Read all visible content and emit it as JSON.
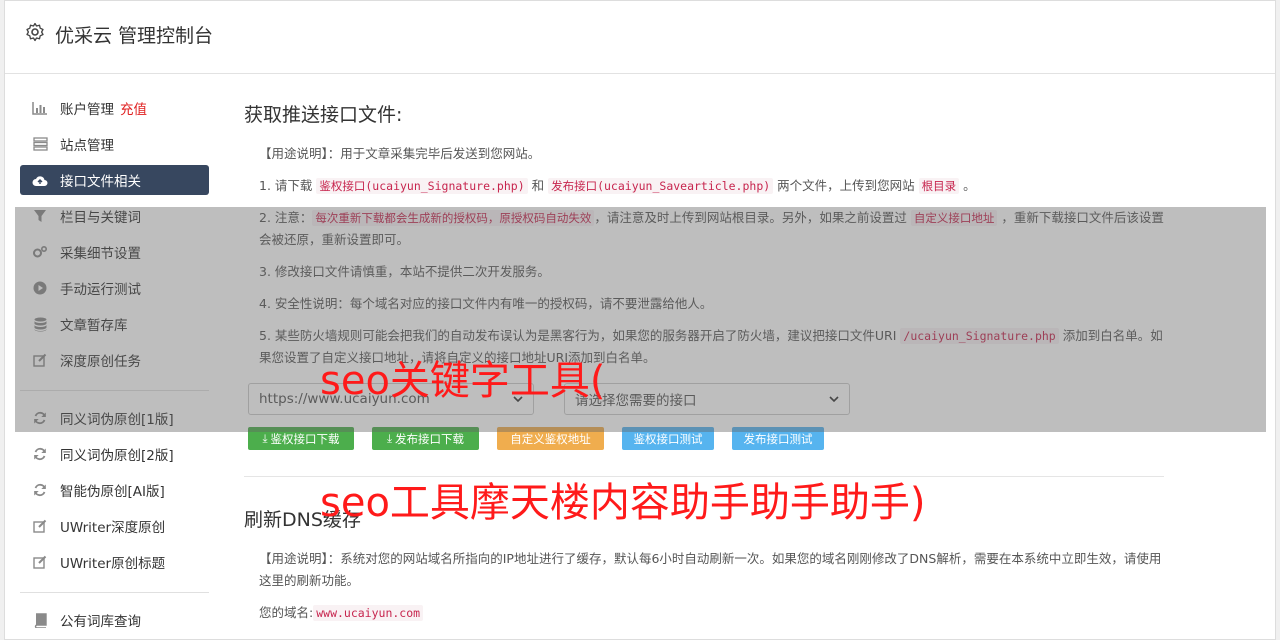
{
  "app": {
    "title": "优采云 管理控制台"
  },
  "sidebar": {
    "items": [
      {
        "label": "账户管理",
        "extra": "充值",
        "icon": "bar-chart-icon"
      },
      {
        "label": "站点管理",
        "icon": "server-icon"
      },
      {
        "label": "接口文件相关",
        "icon": "cloud-upload-icon",
        "active": true
      },
      {
        "label": "栏目与关键词",
        "icon": "filter-icon"
      },
      {
        "label": "采集细节设置",
        "icon": "cogs-icon"
      },
      {
        "label": "手动运行测试",
        "icon": "play-circle-icon"
      },
      {
        "label": "文章暂存库",
        "icon": "database-icon"
      },
      {
        "label": "深度原创任务",
        "icon": "edit-icon"
      }
    ],
    "items2": [
      {
        "label": "同义词伪原创[1版]",
        "icon": "refresh-icon"
      },
      {
        "label": "同义词伪原创[2版]",
        "icon": "refresh-icon"
      },
      {
        "label": "智能伪原创[AI版]",
        "icon": "refresh-icon"
      },
      {
        "label": "UWriter深度原创",
        "icon": "edit-icon"
      },
      {
        "label": "UWriter原创标题",
        "icon": "edit-icon"
      }
    ],
    "items3": [
      {
        "label": "公有词库查询",
        "icon": "book-icon"
      }
    ]
  },
  "section1": {
    "title": "获取推送接口文件:",
    "usage": "【用途说明】：用于文章采集完毕后发送到您网站。",
    "p1": {
      "a": "1. 请下载 ",
      "c1": "鉴权接口(ucaiyun_Signature.php)",
      "b": " 和 ",
      "c2": "发布接口(ucaiyun_Savearticle.php)",
      "c": " 两个文件，上传到您网站 ",
      "c3": "根目录",
      "d": " 。"
    },
    "p2": {
      "a": "2. 注意：",
      "c1": "每次重新下载都会生成新的授权码，原授权码自动失效",
      "b": "，请注意及时上传到网站根目录。另外，如果之前设置过 ",
      "c2": "自定义接口地址",
      "c": " ，重新下载接口文件后该设置会被还原，重新设置即可。"
    },
    "p3": "3. 修改接口文件请慎重，本站不提供二次开发服务。",
    "p4": "4. 安全性说明：每个域名对应的接口文件内有唯一的授权码，请不要泄露给他人。",
    "p5": {
      "a": "5. 某些防火墙规则可能会把我们的自动发布误认为是黑客行为，如果您的服务器开启了防火墙，建议把接口文件URI ",
      "c1": "/ucaiyun_Signature.php",
      "b": " 添加到白名单。如果您设置了自定义接口地址，请将自定义的接口地址URI添加到白名单。"
    },
    "select_site": "https://www.ucaiyun.com",
    "select_api": "请选择您需要的接口",
    "buttons": {
      "auth_download": "鉴权接口下载",
      "publish_download": "发布接口下载",
      "custom_auth_addr": "自定义鉴权地址",
      "auth_test": "鉴权接口测试",
      "publish_test": "发布接口测试"
    }
  },
  "section2": {
    "title": "刷新DNS缓存",
    "usage": "【用途说明】：系统对您的网站域名所指向的IP地址进行了缓存，默认每6小时自动刷新一次。如果您的域名刚刚修改了DNS解析，需要在本系统中立即生效，请使用这里的刷新功能。",
    "domain_label": "您的域名:",
    "domain": "www.ucaiyun.com"
  },
  "watermark": {
    "line1": "seo关键字工具(",
    "line2": "seo工具摩天楼内容助手助手助手)"
  },
  "colors": {
    "active_nav": "#37475f",
    "accent_red": "#e02020",
    "green": "#4cae4c",
    "orange": "#f0ad4e",
    "blue": "#56b4ef",
    "watermark": "#ff1a1a"
  }
}
